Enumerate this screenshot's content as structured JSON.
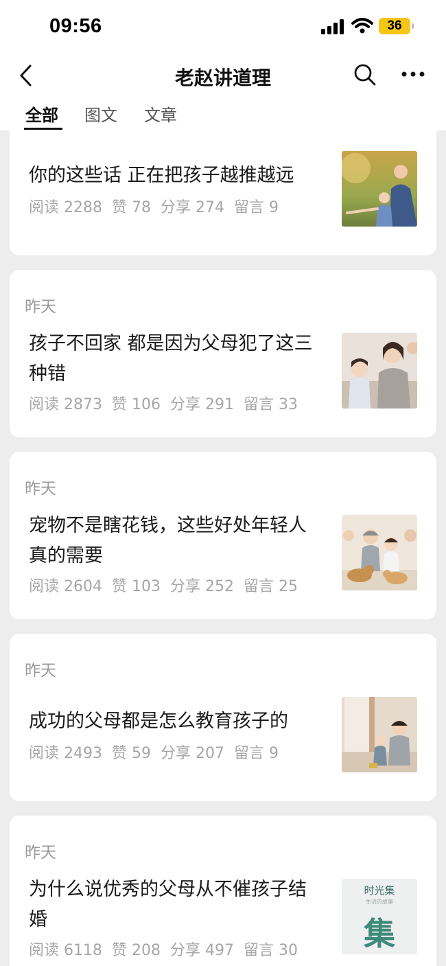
{
  "status_bar": {
    "time": "09:56",
    "battery": "36"
  },
  "nav": {
    "title": "老赵讲道理"
  },
  "tabs": [
    {
      "label": "全部",
      "active": true
    },
    {
      "label": "图文",
      "active": false
    },
    {
      "label": "文章",
      "active": false
    }
  ],
  "articles": [
    {
      "date": "",
      "title": "你的这些话 正在把孩子越推越远",
      "stats": {
        "read": "阅读 2288",
        "like": "赞 78",
        "share": "分享 274",
        "comment": "留言 9"
      },
      "thumb_icon": "father-daughter-park-photo"
    },
    {
      "date": "昨天",
      "title": "孩子不回家 都是因为父母犯了这三种错",
      "stats": {
        "read": "阅读 2873",
        "like": "赞 106",
        "share": "分享 291",
        "comment": "留言 33"
      },
      "thumb_icon": "family-sofa-photo"
    },
    {
      "date": "昨天",
      "title": "宠物不是瞎花钱，这些好处年轻人真的需要",
      "stats": {
        "read": "阅读 2604",
        "like": "赞 103",
        "share": "分享 252",
        "comment": "留言 25"
      },
      "thumb_icon": "family-with-dogs-photo"
    },
    {
      "date": "昨天",
      "title": "成功的父母都是怎么教育孩子的",
      "stats": {
        "read": "阅读 2493",
        "like": "赞 59",
        "share": "分享 207",
        "comment": "留言 9"
      },
      "thumb_icon": "parent-child-living-room-photo"
    },
    {
      "date": "昨天",
      "title": "为什么说优秀的父母从不催孩子结婚",
      "stats": {
        "read": "阅读 6118",
        "like": "赞 208",
        "share": "分享 497",
        "comment": "留言 30"
      },
      "thumb_icon": "book-cover-image",
      "thumb_heading": "时光集",
      "thumb_sub": "生活的故事",
      "thumb_glyph": "集"
    }
  ],
  "colors": {
    "background": "#ededed",
    "card": "#ffffff",
    "battery": "#f5c518",
    "meta_text": "#a6a6a6"
  }
}
